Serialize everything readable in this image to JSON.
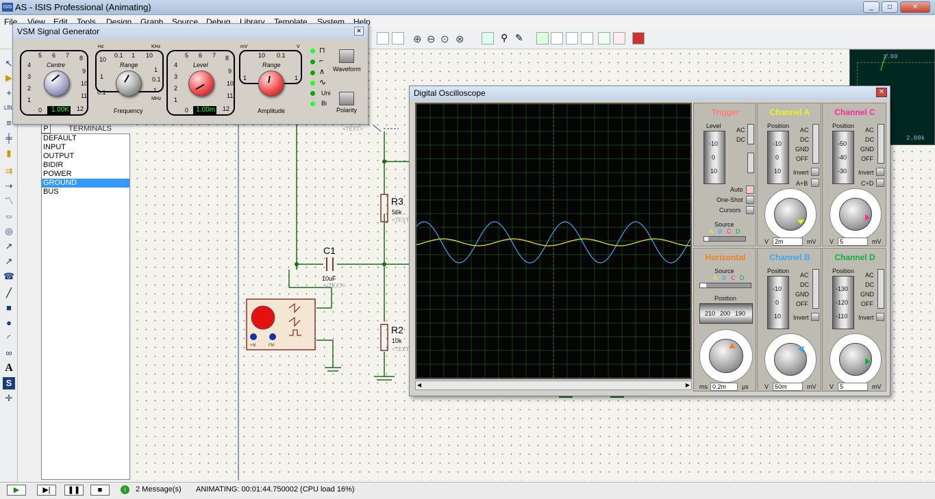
{
  "app": {
    "title": "AS - ISIS Professional (Animating)",
    "icon_label": "ISIS"
  },
  "menu": [
    "File",
    "View",
    "Edit",
    "Tools",
    "Design",
    "Graph",
    "Source",
    "Debug",
    "Library",
    "Template",
    "System",
    "Help"
  ],
  "terminals": {
    "header_p": "P",
    "header": "TERMINALS",
    "items": [
      "DEFAULT",
      "INPUT",
      "OUTPUT",
      "BIDIR",
      "POWER",
      "GROUND",
      "BUS"
    ],
    "selected": "GROUND"
  },
  "siggen": {
    "title": "VSM Signal Generator",
    "centre": {
      "label": "Centre",
      "display": "1.00K",
      "scale": [
        "5",
        "6",
        "7",
        "8",
        "4",
        "9",
        "3",
        "10",
        "2",
        "11",
        "1",
        "0",
        "12"
      ]
    },
    "frequency": {
      "range_label": "Range",
      "caption": "Frequency",
      "units": [
        "Hz",
        "KHz",
        "MHz"
      ],
      "range_values": [
        "10",
        "0.1",
        "1",
        "10",
        "1",
        "0.1",
        "1",
        "0.1",
        "1"
      ]
    },
    "level": {
      "label": "Level",
      "display": "1.00m",
      "scale": [
        "5",
        "6",
        "7",
        "8",
        "4",
        "9",
        "3",
        "10",
        "2",
        "11",
        "1",
        "0",
        "12"
      ]
    },
    "amplitude": {
      "range_label": "Range",
      "caption": "Amplitude",
      "units": [
        "mV",
        "V"
      ],
      "range_values": [
        "10",
        "0.1",
        "1",
        "1"
      ]
    },
    "waveform_label": "Waveform",
    "polarity_label": "Polarity",
    "uni": "Uni",
    "bi": "Bi"
  },
  "schematic": {
    "r3": {
      "ref": "R3",
      "value": "56k",
      "text": "<TEXT>"
    },
    "r2": {
      "ref": "R2",
      "value": "10k",
      "text": "<TEXT>"
    },
    "c1": {
      "ref": "C1",
      "value": "10uF",
      "text": "<TEXT>"
    },
    "text_label": "<TEXT>",
    "gen_pins": [
      "+M",
      "FM"
    ]
  },
  "zoom_panel": {
    "top_value": "1.00",
    "bottom_value": "2.00k"
  },
  "scope": {
    "title": "Digital Oscilloscope",
    "trigger": {
      "title": "Trigger",
      "level_label": "Level",
      "scale": [
        "-10",
        "0",
        "10"
      ],
      "ac": "AC",
      "dc": "DC",
      "auto": "Auto",
      "oneshot": "One-Shot",
      "cursors": "Cursors",
      "source_label": "Source",
      "source_letters": [
        "A",
        "B",
        "C",
        "D"
      ]
    },
    "chan_a": {
      "title": "Channel A",
      "position_label": "Position",
      "scale": [
        "-10",
        "0",
        "10"
      ],
      "coupling": [
        "AC",
        "DC",
        "GND",
        "OFF"
      ],
      "invert": "Invert",
      "combine": "A+B",
      "unit_left": "V",
      "value": "2m",
      "unit_right": "mV",
      "dial": [
        "0.5",
        "0.2",
        "0.1",
        "1",
        "50",
        "2",
        "20",
        "5",
        "10",
        "10",
        "5",
        "20",
        "2"
      ]
    },
    "chan_c": {
      "title": "Channel C",
      "position_label": "Position",
      "scale": [
        "-50",
        "-40",
        "-30"
      ],
      "coupling": [
        "AC",
        "DC",
        "GND",
        "OFF"
      ],
      "invert": "Invert",
      "combine": "C+D",
      "unit_left": "V",
      "value": "5",
      "unit_right": "mV",
      "dial": [
        "0.5",
        "0.2",
        "0.1",
        "1",
        "50",
        "2",
        "20",
        "5",
        "10",
        "10",
        "5",
        "20",
        "2"
      ]
    },
    "horizontal": {
      "title": "Horizontal",
      "source_label": "Source",
      "source_letters": [
        "A",
        "B",
        "C",
        "D"
      ],
      "position_label": "Position",
      "pos_scale": [
        "210",
        "200",
        "190"
      ],
      "unit_left": "ms",
      "value": "0.2m",
      "unit_right": "µs",
      "dial": [
        "0.5",
        "0.2",
        "0.1",
        "1",
        "50",
        "2",
        "20",
        "5",
        "10",
        "10",
        "5",
        "20",
        "2",
        "50",
        "1",
        "100",
        "0.5",
        "200",
        "0.2"
      ]
    },
    "chan_b": {
      "title": "Channel B",
      "position_label": "Position",
      "scale": [
        "-10",
        "0",
        "10"
      ],
      "coupling": [
        "AC",
        "DC",
        "GND",
        "OFF"
      ],
      "invert": "Invert",
      "unit_left": "V",
      "value": "50m",
      "unit_right": "mV",
      "dial": [
        "0.5",
        "0.2",
        "0.1",
        "1",
        "50",
        "2",
        "20",
        "5",
        "10",
        "10",
        "5",
        "20",
        "2"
      ]
    },
    "chan_d": {
      "title": "Channel D",
      "position_label": "Position",
      "scale": [
        "-130",
        "-120",
        "-110"
      ],
      "coupling": [
        "AC",
        "DC",
        "GND",
        "OFF"
      ],
      "invert": "Invert",
      "unit_left": "V",
      "value": "5",
      "unit_right": "mV",
      "dial": [
        "0.5",
        "0.2",
        "0.1",
        "1",
        "50",
        "2",
        "20",
        "5",
        "10",
        "10",
        "5",
        "20",
        "2"
      ]
    },
    "colors": {
      "chan_a": "#f0f020",
      "chan_b": "#3aa8f0",
      "chan_c": "#ff2a9a",
      "chan_d": "#10b040",
      "horizontal": "#f08020",
      "trigger": "#ff7a7a",
      "grid": "#1e5a1e"
    }
  },
  "status": {
    "messages": "2 Message(s)",
    "animating": "ANIMATING: 00:01:44.750002 (CPU load 16%)"
  }
}
